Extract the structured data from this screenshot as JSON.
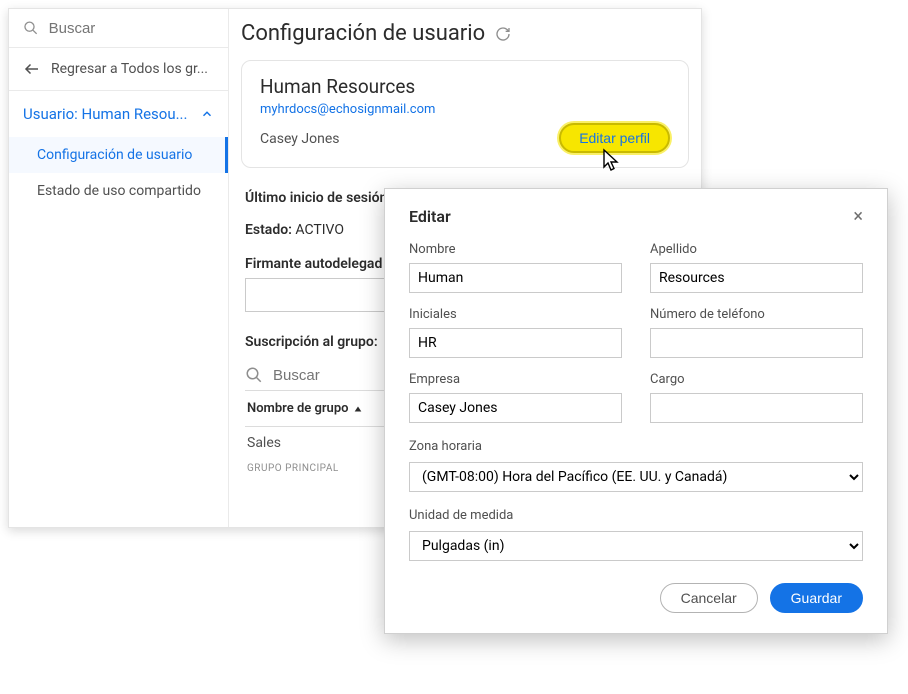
{
  "sidebar": {
    "search_placeholder": "Buscar",
    "back_label": "Regresar a Todos los gr...",
    "accordion_label": "Usuario: Human Resou...",
    "items": [
      {
        "label": "Configuración de usuario"
      },
      {
        "label": "Estado de uso compartido"
      }
    ]
  },
  "page": {
    "title": "Configuración de usuario"
  },
  "profile": {
    "name": "Human Resources",
    "email": "myhrdocs@echosignmail.com",
    "owner": "Casey Jones",
    "edit_label": "Editar perfil"
  },
  "info": {
    "last_login_label": "Último inicio de sesión:",
    "status_label": "Estado:",
    "status_value": "ACTIVO"
  },
  "delegation": {
    "label": "Firmante autodelegad"
  },
  "group": {
    "title": "Suscripción al grupo:",
    "search_placeholder": "Buscar",
    "col_name": "Nombre de grupo",
    "rows": [
      {
        "name": "Sales"
      }
    ],
    "badge": "GRUPO PRINCIPAL"
  },
  "modal": {
    "title": "Editar",
    "fields": {
      "first_name": {
        "label": "Nombre",
        "value": "Human"
      },
      "last_name": {
        "label": "Apellido",
        "value": "Resources"
      },
      "initials": {
        "label": "Iniciales",
        "value": "HR"
      },
      "phone": {
        "label": "Número de teléfono",
        "value": ""
      },
      "company": {
        "label": "Empresa",
        "value": "Casey Jones"
      },
      "position": {
        "label": "Cargo",
        "value": ""
      }
    },
    "timezone": {
      "label": "Zona horaria",
      "value": "(GMT-08:00) Hora del Pacífico (EE. UU. y Canadá)"
    },
    "unit": {
      "label": "Unidad de medida",
      "value": "Pulgadas (in)"
    },
    "cancel": "Cancelar",
    "save": "Guardar"
  }
}
